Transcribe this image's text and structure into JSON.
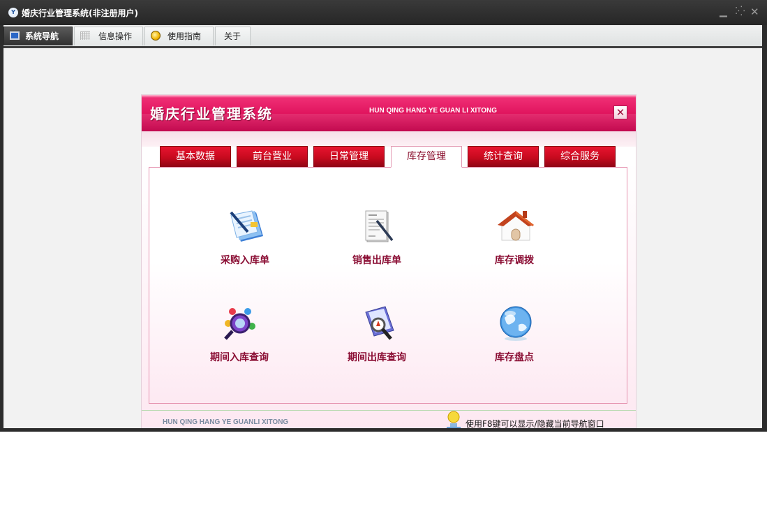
{
  "window": {
    "title": "婚庆行业管理系统(非注册用户)",
    "logo_text": "Y",
    "controls": {
      "minimize": "▁",
      "maximize": "⁚⁛",
      "close": "✕"
    }
  },
  "menubar": {
    "tabs": [
      {
        "label": "系统导航",
        "icon": "monitor-icon",
        "active": true
      },
      {
        "label": "信息操作",
        "icon": "grid-icon",
        "active": false
      },
      {
        "label": "使用指南",
        "icon": "guide-icon",
        "active": false
      },
      {
        "label": "关于",
        "icon": null,
        "active": false
      }
    ]
  },
  "nav_panel": {
    "title": "婚庆行业管理系统",
    "subtitle": "HUN QING HANG YE GUAN LI XITONG",
    "close_glyph": "✕",
    "tabs": [
      {
        "label": "基本数据",
        "active": false
      },
      {
        "label": "前台营业",
        "active": false
      },
      {
        "label": "日常管理",
        "active": false
      },
      {
        "label": "库存管理",
        "active": true
      },
      {
        "label": "统计查询",
        "active": false
      },
      {
        "label": "综合服务",
        "active": false
      }
    ],
    "items": [
      {
        "label": "采购入库单",
        "icon": "purchase-doc-icon"
      },
      {
        "label": "销售出库单",
        "icon": "sales-doc-icon"
      },
      {
        "label": "库存调拨",
        "icon": "house-icon"
      },
      {
        "label": "期间入库查询",
        "icon": "magnifier-icon"
      },
      {
        "label": "期间出库查询",
        "icon": "search-doc-icon"
      },
      {
        "label": "库存盘点",
        "icon": "globe-icon"
      }
    ],
    "footer_left": "HUN QING HANG YE GUANLI XITONG",
    "footer_tip": "使用F8键可以显示/隐藏当前导航窗口"
  },
  "colors": {
    "header_red": "#e1155f",
    "tab_red": "#c60a1e",
    "label_crimson": "#8a0d33",
    "title_bar": "#2c2c2c"
  }
}
